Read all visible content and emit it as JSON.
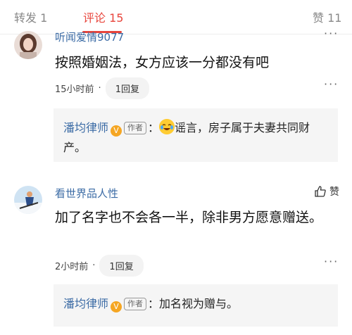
{
  "tabs": {
    "repost": "转发 1",
    "comment": "评论 15",
    "like": "赞 11"
  },
  "comments": [
    {
      "username": "听闻爱情9077",
      "text": "按照婚姻法，女方应该一分都没有吧",
      "time": "15小时前",
      "dot": "·",
      "reply_count": "1回复",
      "reply": {
        "author": "潘均律师",
        "badge": "作者",
        "colon": "：",
        "text": "谣言，房子属于夫妻共同财产。"
      }
    },
    {
      "username": "看世界品人性",
      "like_label": "赞",
      "text": "加了名字也不会各一半，除非男方愿意赠送。",
      "time": "2小时前",
      "dot": "·",
      "reply_count": "1回复",
      "reply": {
        "author": "潘均律师",
        "badge": "作者",
        "colon": "：",
        "text": "加名视为赠与。"
      }
    }
  ],
  "icons": {
    "more": "more-dots-icon",
    "like": "thumb-up-icon",
    "verified": "verified-v-icon",
    "emoji": "crying-laugh-emoji-icon"
  },
  "colors": {
    "accent": "#e8453c",
    "link": "#3b6ba5",
    "verified": "#f5a623"
  }
}
